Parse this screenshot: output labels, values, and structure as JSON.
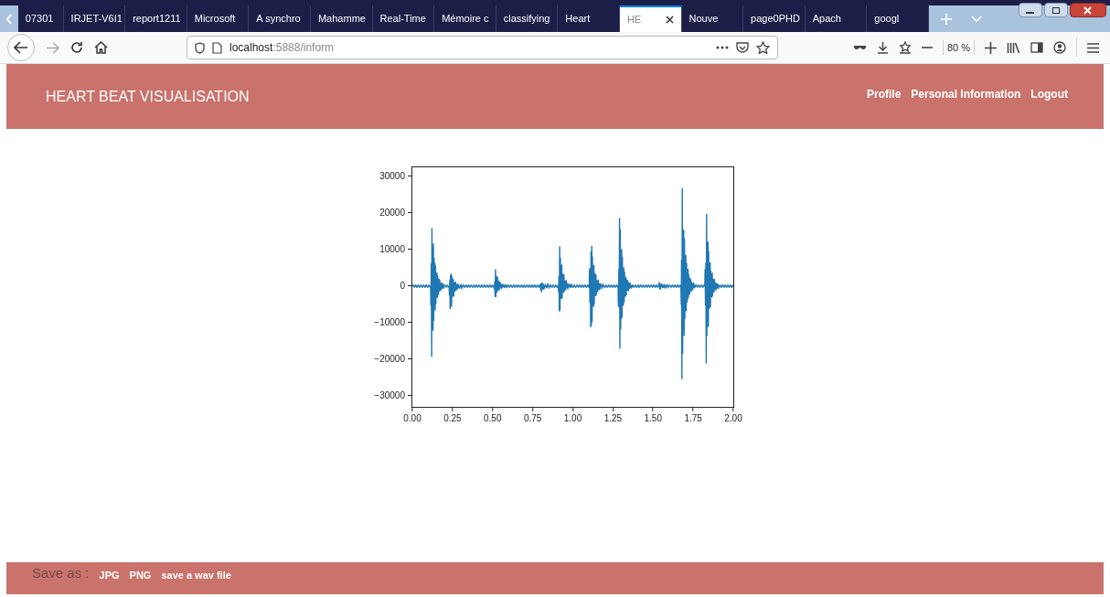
{
  "browser": {
    "tabs": [
      {
        "label": "07301",
        "selected": false
      },
      {
        "label": "IRJET-V6I1",
        "selected": false
      },
      {
        "label": "report1211",
        "selected": false
      },
      {
        "label": "Microsoft",
        "selected": false
      },
      {
        "label": "A synchro",
        "selected": false
      },
      {
        "label": "Mahamme",
        "selected": false
      },
      {
        "label": "Real-Time",
        "selected": false
      },
      {
        "label": "Mémoire c",
        "selected": false
      },
      {
        "label": "classifying",
        "selected": false
      },
      {
        "label": "Heart",
        "selected": false
      },
      {
        "label": "HE",
        "selected": true
      },
      {
        "label": "Nouve",
        "selected": false
      },
      {
        "label": "page0PHD",
        "selected": false
      },
      {
        "label": "Apach",
        "selected": false
      },
      {
        "label": "googl",
        "selected": false
      }
    ],
    "url_host": "localhost",
    "url_path": ":5888/inform",
    "zoom": "80 %"
  },
  "header": {
    "title": "HEART BEAT VISUALISATION",
    "nav": [
      "Profile",
      "Personal Information",
      "Logout"
    ]
  },
  "plot": {
    "yticks": [
      "30000",
      "20000",
      "10000",
      "0",
      "−10000",
      "−20000",
      "−30000"
    ],
    "xticks": [
      "0.00",
      "0.25",
      "0.50",
      "0.75",
      "1.00",
      "1.25",
      "1.50",
      "1.75",
      "2.00"
    ]
  },
  "footer": {
    "label": "Save as :",
    "links": [
      "JPG",
      "PNG",
      "save a wav file"
    ]
  }
}
